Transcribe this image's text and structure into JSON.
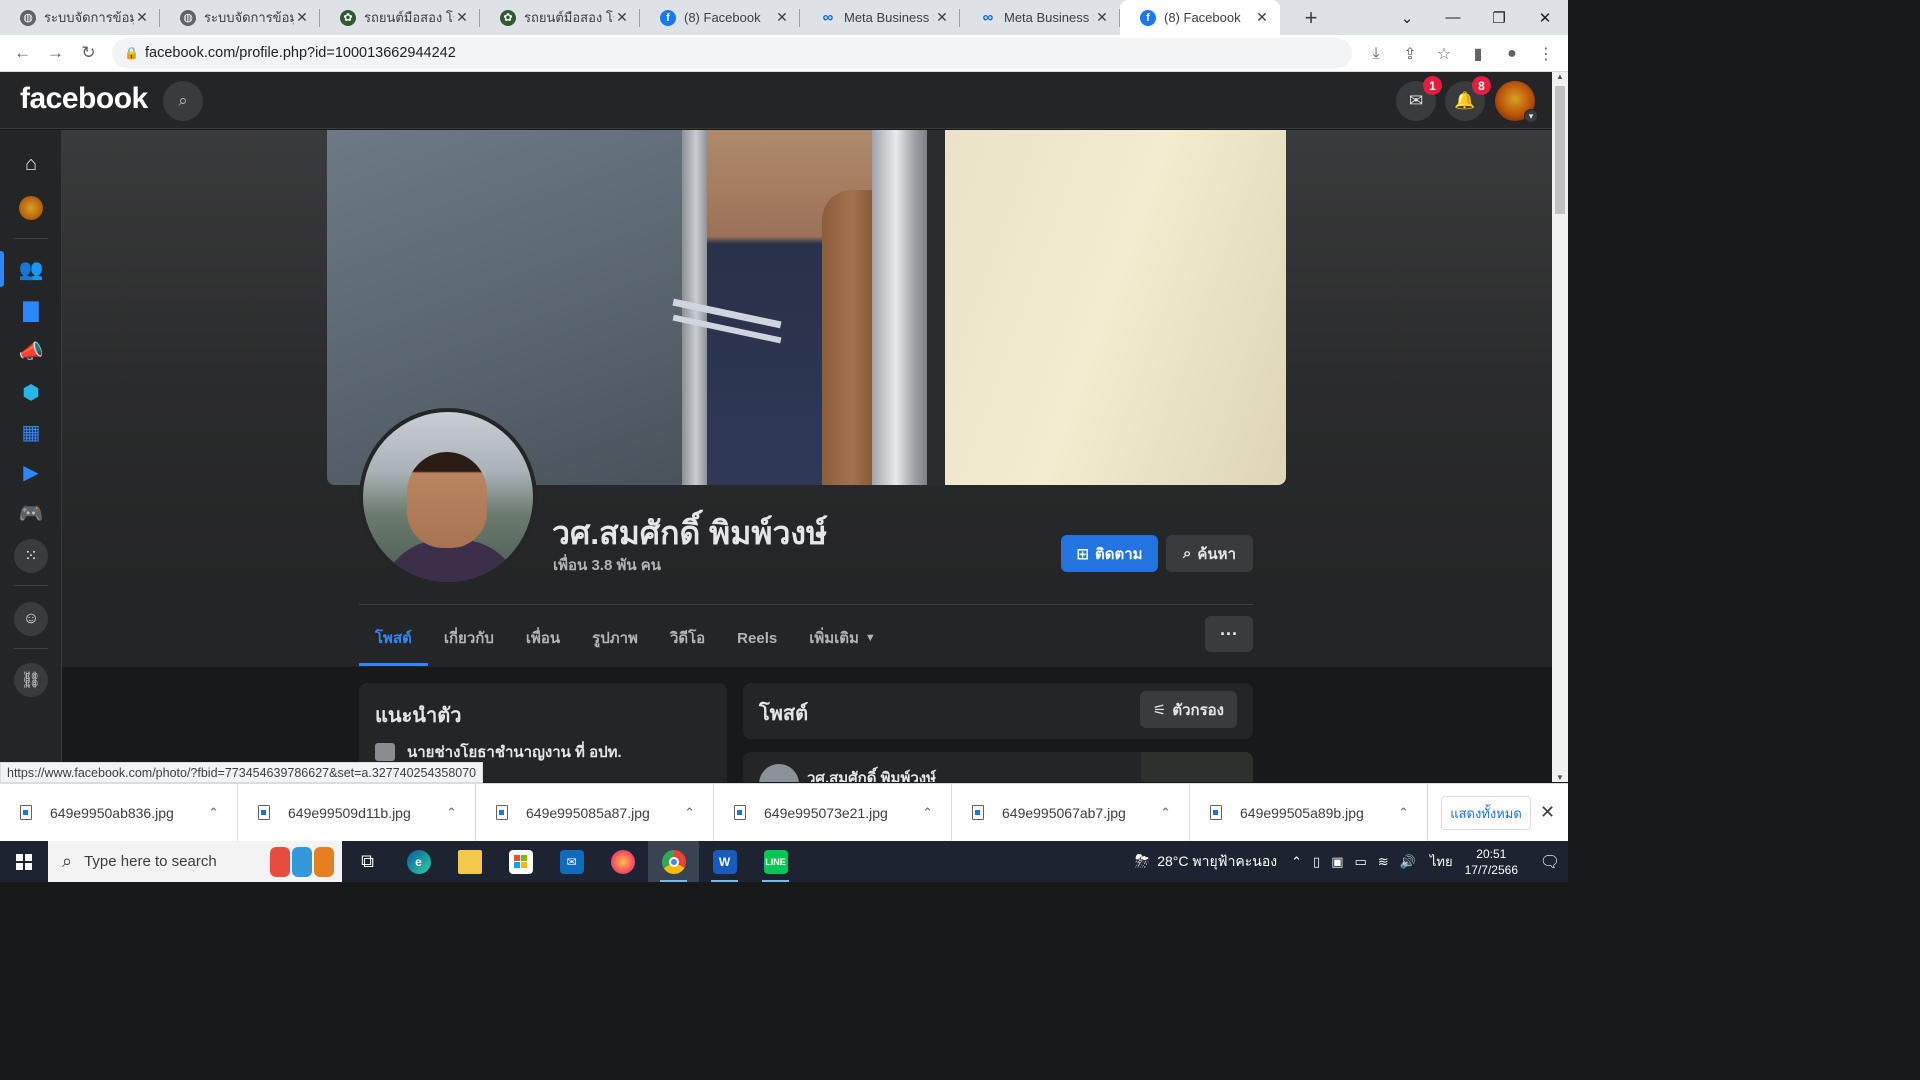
{
  "browser": {
    "tabs": [
      {
        "title": "ระบบจัดการข้อมูล บ",
        "icon": "globe-icon"
      },
      {
        "title": "ระบบจัดการข้อมูล บ",
        "icon": "globe-icon"
      },
      {
        "title": "รถยนต์มือสอง โชคดู",
        "icon": "dealer-logo-icon"
      },
      {
        "title": "รถยนต์มือสอง โชคดู",
        "icon": "dealer-logo-icon"
      },
      {
        "title": "(8) Facebook",
        "icon": "facebook-icon"
      },
      {
        "title": "Meta Business Su",
        "icon": "meta-icon"
      },
      {
        "title": "Meta Business Su",
        "icon": "meta-icon"
      },
      {
        "title": "(8) Facebook",
        "icon": "facebook-icon",
        "active": true
      }
    ],
    "url": "facebook.com/profile.php?id=100013662944242",
    "status_url": "https://www.facebook.com/photo/?fbid=773454639786627&set=a.327740254358070"
  },
  "facebook": {
    "logo": "facebook",
    "messenger_badge": "1",
    "notifications_badge": "8"
  },
  "profile": {
    "name": "วศ.สมศักดิ์ พิมพ์วงษ์",
    "friends": "เพื่อน 3.8 พัน คน",
    "follow_label": "ติดตาม",
    "search_label": "ค้นหา",
    "tabs": [
      "โพสต์",
      "เกี่ยวกับ",
      "เพื่อน",
      "รูปภาพ",
      "วิดีโอ",
      "Reels",
      "เพิ่มเติม"
    ],
    "more_dots": "···"
  },
  "intro": {
    "title": "แนะนำตัว",
    "work": "นายช่างโยธาชำนาญงาน ที่ อปท."
  },
  "posts": {
    "title": "โพสต์",
    "filter_label": "ตัวกรอง",
    "first_post_author": "วศ.สมศักดิ์ พิมพ์วงษ์"
  },
  "downloads": {
    "files": [
      "649e9950ab836.jpg",
      "649e99509d11b.jpg",
      "649e995085a87.jpg",
      "649e995073e21.jpg",
      "649e995067ab7.jpg",
      "649e99505a89b.jpg"
    ],
    "show_all": "แสดงทั้งหมด"
  },
  "taskbar": {
    "search_placeholder": "Type here to search",
    "weather": "28°C พายุฟ้าคะนอง",
    "language": "ไทย",
    "time": "20:51",
    "date": "17/7/2566"
  }
}
